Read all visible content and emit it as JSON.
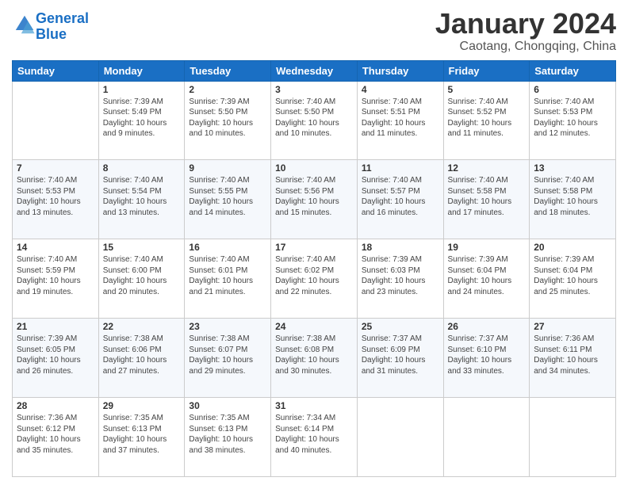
{
  "header": {
    "logo_line1": "General",
    "logo_line2": "Blue",
    "month_title": "January 2024",
    "location": "Caotang, Chongqing, China"
  },
  "days_of_week": [
    "Sunday",
    "Monday",
    "Tuesday",
    "Wednesday",
    "Thursday",
    "Friday",
    "Saturday"
  ],
  "weeks": [
    [
      {
        "day": "",
        "info": ""
      },
      {
        "day": "1",
        "info": "Sunrise: 7:39 AM\nSunset: 5:49 PM\nDaylight: 10 hours\nand 9 minutes."
      },
      {
        "day": "2",
        "info": "Sunrise: 7:39 AM\nSunset: 5:50 PM\nDaylight: 10 hours\nand 10 minutes."
      },
      {
        "day": "3",
        "info": "Sunrise: 7:40 AM\nSunset: 5:50 PM\nDaylight: 10 hours\nand 10 minutes."
      },
      {
        "day": "4",
        "info": "Sunrise: 7:40 AM\nSunset: 5:51 PM\nDaylight: 10 hours\nand 11 minutes."
      },
      {
        "day": "5",
        "info": "Sunrise: 7:40 AM\nSunset: 5:52 PM\nDaylight: 10 hours\nand 11 minutes."
      },
      {
        "day": "6",
        "info": "Sunrise: 7:40 AM\nSunset: 5:53 PM\nDaylight: 10 hours\nand 12 minutes."
      }
    ],
    [
      {
        "day": "7",
        "info": "Sunrise: 7:40 AM\nSunset: 5:53 PM\nDaylight: 10 hours\nand 13 minutes."
      },
      {
        "day": "8",
        "info": "Sunrise: 7:40 AM\nSunset: 5:54 PM\nDaylight: 10 hours\nand 13 minutes."
      },
      {
        "day": "9",
        "info": "Sunrise: 7:40 AM\nSunset: 5:55 PM\nDaylight: 10 hours\nand 14 minutes."
      },
      {
        "day": "10",
        "info": "Sunrise: 7:40 AM\nSunset: 5:56 PM\nDaylight: 10 hours\nand 15 minutes."
      },
      {
        "day": "11",
        "info": "Sunrise: 7:40 AM\nSunset: 5:57 PM\nDaylight: 10 hours\nand 16 minutes."
      },
      {
        "day": "12",
        "info": "Sunrise: 7:40 AM\nSunset: 5:58 PM\nDaylight: 10 hours\nand 17 minutes."
      },
      {
        "day": "13",
        "info": "Sunrise: 7:40 AM\nSunset: 5:58 PM\nDaylight: 10 hours\nand 18 minutes."
      }
    ],
    [
      {
        "day": "14",
        "info": "Sunrise: 7:40 AM\nSunset: 5:59 PM\nDaylight: 10 hours\nand 19 minutes."
      },
      {
        "day": "15",
        "info": "Sunrise: 7:40 AM\nSunset: 6:00 PM\nDaylight: 10 hours\nand 20 minutes."
      },
      {
        "day": "16",
        "info": "Sunrise: 7:40 AM\nSunset: 6:01 PM\nDaylight: 10 hours\nand 21 minutes."
      },
      {
        "day": "17",
        "info": "Sunrise: 7:40 AM\nSunset: 6:02 PM\nDaylight: 10 hours\nand 22 minutes."
      },
      {
        "day": "18",
        "info": "Sunrise: 7:39 AM\nSunset: 6:03 PM\nDaylight: 10 hours\nand 23 minutes."
      },
      {
        "day": "19",
        "info": "Sunrise: 7:39 AM\nSunset: 6:04 PM\nDaylight: 10 hours\nand 24 minutes."
      },
      {
        "day": "20",
        "info": "Sunrise: 7:39 AM\nSunset: 6:04 PM\nDaylight: 10 hours\nand 25 minutes."
      }
    ],
    [
      {
        "day": "21",
        "info": "Sunrise: 7:39 AM\nSunset: 6:05 PM\nDaylight: 10 hours\nand 26 minutes."
      },
      {
        "day": "22",
        "info": "Sunrise: 7:38 AM\nSunset: 6:06 PM\nDaylight: 10 hours\nand 27 minutes."
      },
      {
        "day": "23",
        "info": "Sunrise: 7:38 AM\nSunset: 6:07 PM\nDaylight: 10 hours\nand 29 minutes."
      },
      {
        "day": "24",
        "info": "Sunrise: 7:38 AM\nSunset: 6:08 PM\nDaylight: 10 hours\nand 30 minutes."
      },
      {
        "day": "25",
        "info": "Sunrise: 7:37 AM\nSunset: 6:09 PM\nDaylight: 10 hours\nand 31 minutes."
      },
      {
        "day": "26",
        "info": "Sunrise: 7:37 AM\nSunset: 6:10 PM\nDaylight: 10 hours\nand 33 minutes."
      },
      {
        "day": "27",
        "info": "Sunrise: 7:36 AM\nSunset: 6:11 PM\nDaylight: 10 hours\nand 34 minutes."
      }
    ],
    [
      {
        "day": "28",
        "info": "Sunrise: 7:36 AM\nSunset: 6:12 PM\nDaylight: 10 hours\nand 35 minutes."
      },
      {
        "day": "29",
        "info": "Sunrise: 7:35 AM\nSunset: 6:13 PM\nDaylight: 10 hours\nand 37 minutes."
      },
      {
        "day": "30",
        "info": "Sunrise: 7:35 AM\nSunset: 6:13 PM\nDaylight: 10 hours\nand 38 minutes."
      },
      {
        "day": "31",
        "info": "Sunrise: 7:34 AM\nSunset: 6:14 PM\nDaylight: 10 hours\nand 40 minutes."
      },
      {
        "day": "",
        "info": ""
      },
      {
        "day": "",
        "info": ""
      },
      {
        "day": "",
        "info": ""
      }
    ]
  ]
}
